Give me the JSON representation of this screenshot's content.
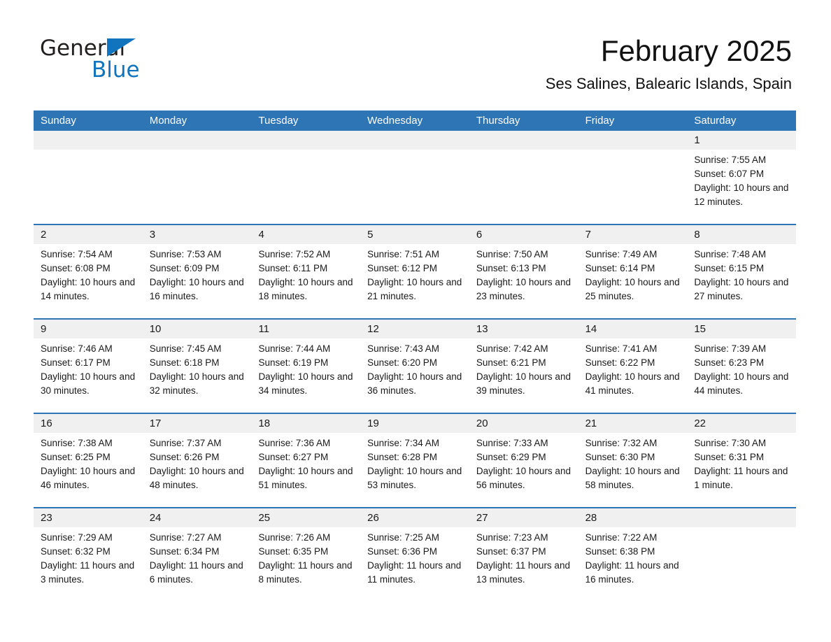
{
  "brand": {
    "name_part1": "General",
    "name_part2": "Blue",
    "triangle_color": "#1274bc"
  },
  "header": {
    "month_title": "February 2025",
    "location": "Ses Salines, Balearic Islands, Spain",
    "header_color": "#2e75b6"
  },
  "weekdays": [
    "Sunday",
    "Monday",
    "Tuesday",
    "Wednesday",
    "Thursday",
    "Friday",
    "Saturday"
  ],
  "weeks": [
    [
      {
        "day": "",
        "sunrise": "",
        "sunset": "",
        "daylight": "",
        "empty": true
      },
      {
        "day": "",
        "sunrise": "",
        "sunset": "",
        "daylight": "",
        "empty": true
      },
      {
        "day": "",
        "sunrise": "",
        "sunset": "",
        "daylight": "",
        "empty": true
      },
      {
        "day": "",
        "sunrise": "",
        "sunset": "",
        "daylight": "",
        "empty": true
      },
      {
        "day": "",
        "sunrise": "",
        "sunset": "",
        "daylight": "",
        "empty": true
      },
      {
        "day": "",
        "sunrise": "",
        "sunset": "",
        "daylight": "",
        "empty": true
      },
      {
        "day": "1",
        "sunrise": "Sunrise: 7:55 AM",
        "sunset": "Sunset: 6:07 PM",
        "daylight": "Daylight: 10 hours and 12 minutes.",
        "empty": false
      }
    ],
    [
      {
        "day": "2",
        "sunrise": "Sunrise: 7:54 AM",
        "sunset": "Sunset: 6:08 PM",
        "daylight": "Daylight: 10 hours and 14 minutes.",
        "empty": false
      },
      {
        "day": "3",
        "sunrise": "Sunrise: 7:53 AM",
        "sunset": "Sunset: 6:09 PM",
        "daylight": "Daylight: 10 hours and 16 minutes.",
        "empty": false
      },
      {
        "day": "4",
        "sunrise": "Sunrise: 7:52 AM",
        "sunset": "Sunset: 6:11 PM",
        "daylight": "Daylight: 10 hours and 18 minutes.",
        "empty": false
      },
      {
        "day": "5",
        "sunrise": "Sunrise: 7:51 AM",
        "sunset": "Sunset: 6:12 PM",
        "daylight": "Daylight: 10 hours and 21 minutes.",
        "empty": false
      },
      {
        "day": "6",
        "sunrise": "Sunrise: 7:50 AM",
        "sunset": "Sunset: 6:13 PM",
        "daylight": "Daylight: 10 hours and 23 minutes.",
        "empty": false
      },
      {
        "day": "7",
        "sunrise": "Sunrise: 7:49 AM",
        "sunset": "Sunset: 6:14 PM",
        "daylight": "Daylight: 10 hours and 25 minutes.",
        "empty": false
      },
      {
        "day": "8",
        "sunrise": "Sunrise: 7:48 AM",
        "sunset": "Sunset: 6:15 PM",
        "daylight": "Daylight: 10 hours and 27 minutes.",
        "empty": false
      }
    ],
    [
      {
        "day": "9",
        "sunrise": "Sunrise: 7:46 AM",
        "sunset": "Sunset: 6:17 PM",
        "daylight": "Daylight: 10 hours and 30 minutes.",
        "empty": false
      },
      {
        "day": "10",
        "sunrise": "Sunrise: 7:45 AM",
        "sunset": "Sunset: 6:18 PM",
        "daylight": "Daylight: 10 hours and 32 minutes.",
        "empty": false
      },
      {
        "day": "11",
        "sunrise": "Sunrise: 7:44 AM",
        "sunset": "Sunset: 6:19 PM",
        "daylight": "Daylight: 10 hours and 34 minutes.",
        "empty": false
      },
      {
        "day": "12",
        "sunrise": "Sunrise: 7:43 AM",
        "sunset": "Sunset: 6:20 PM",
        "daylight": "Daylight: 10 hours and 36 minutes.",
        "empty": false
      },
      {
        "day": "13",
        "sunrise": "Sunrise: 7:42 AM",
        "sunset": "Sunset: 6:21 PM",
        "daylight": "Daylight: 10 hours and 39 minutes.",
        "empty": false
      },
      {
        "day": "14",
        "sunrise": "Sunrise: 7:41 AM",
        "sunset": "Sunset: 6:22 PM",
        "daylight": "Daylight: 10 hours and 41 minutes.",
        "empty": false
      },
      {
        "day": "15",
        "sunrise": "Sunrise: 7:39 AM",
        "sunset": "Sunset: 6:23 PM",
        "daylight": "Daylight: 10 hours and 44 minutes.",
        "empty": false
      }
    ],
    [
      {
        "day": "16",
        "sunrise": "Sunrise: 7:38 AM",
        "sunset": "Sunset: 6:25 PM",
        "daylight": "Daylight: 10 hours and 46 minutes.",
        "empty": false
      },
      {
        "day": "17",
        "sunrise": "Sunrise: 7:37 AM",
        "sunset": "Sunset: 6:26 PM",
        "daylight": "Daylight: 10 hours and 48 minutes.",
        "empty": false
      },
      {
        "day": "18",
        "sunrise": "Sunrise: 7:36 AM",
        "sunset": "Sunset: 6:27 PM",
        "daylight": "Daylight: 10 hours and 51 minutes.",
        "empty": false
      },
      {
        "day": "19",
        "sunrise": "Sunrise: 7:34 AM",
        "sunset": "Sunset: 6:28 PM",
        "daylight": "Daylight: 10 hours and 53 minutes.",
        "empty": false
      },
      {
        "day": "20",
        "sunrise": "Sunrise: 7:33 AM",
        "sunset": "Sunset: 6:29 PM",
        "daylight": "Daylight: 10 hours and 56 minutes.",
        "empty": false
      },
      {
        "day": "21",
        "sunrise": "Sunrise: 7:32 AM",
        "sunset": "Sunset: 6:30 PM",
        "daylight": "Daylight: 10 hours and 58 minutes.",
        "empty": false
      },
      {
        "day": "22",
        "sunrise": "Sunrise: 7:30 AM",
        "sunset": "Sunset: 6:31 PM",
        "daylight": "Daylight: 11 hours and 1 minute.",
        "empty": false
      }
    ],
    [
      {
        "day": "23",
        "sunrise": "Sunrise: 7:29 AM",
        "sunset": "Sunset: 6:32 PM",
        "daylight": "Daylight: 11 hours and 3 minutes.",
        "empty": false
      },
      {
        "day": "24",
        "sunrise": "Sunrise: 7:27 AM",
        "sunset": "Sunset: 6:34 PM",
        "daylight": "Daylight: 11 hours and 6 minutes.",
        "empty": false
      },
      {
        "day": "25",
        "sunrise": "Sunrise: 7:26 AM",
        "sunset": "Sunset: 6:35 PM",
        "daylight": "Daylight: 11 hours and 8 minutes.",
        "empty": false
      },
      {
        "day": "26",
        "sunrise": "Sunrise: 7:25 AM",
        "sunset": "Sunset: 6:36 PM",
        "daylight": "Daylight: 11 hours and 11 minutes.",
        "empty": false
      },
      {
        "day": "27",
        "sunrise": "Sunrise: 7:23 AM",
        "sunset": "Sunset: 6:37 PM",
        "daylight": "Daylight: 11 hours and 13 minutes.",
        "empty": false
      },
      {
        "day": "28",
        "sunrise": "Sunrise: 7:22 AM",
        "sunset": "Sunset: 6:38 PM",
        "daylight": "Daylight: 11 hours and 16 minutes.",
        "empty": false
      },
      {
        "day": "",
        "sunrise": "",
        "sunset": "",
        "daylight": "",
        "empty": true
      }
    ]
  ]
}
